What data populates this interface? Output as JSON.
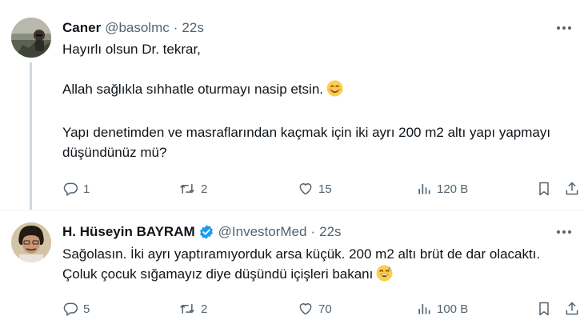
{
  "tweets": [
    {
      "author": {
        "name": "Caner",
        "handle": "@basolmc",
        "verified": false
      },
      "time": "22s",
      "separator": "·",
      "text": [
        "Hayırlı olsun Dr. tekrar,",
        "Allah sağlıkla sıhhatle oturmayı nasip etsin.",
        "Yapı denetimden ve masraflarından kaçmak için iki ayrı 200 m2 altı yapı yapmayı düşündünüz mü?"
      ],
      "emoji": "smiling-face-emoji",
      "stats": {
        "replies": "1",
        "reposts": "2",
        "likes": "15",
        "views": "120 B"
      }
    },
    {
      "author": {
        "name": "H. Hüseyin BAYRAM",
        "handle": "@InvestorMed",
        "verified": true
      },
      "time": "22s",
      "separator": "·",
      "text": [
        "Sağolasın. İki ayrı yaptıramıyorduk arsa küçük. 200 m2 altı brüt de dar olacaktı. Çoluk çocuk sığamayız diye düşündü içişleri bakanı"
      ],
      "emoji": "grinning-sweat-emoji",
      "stats": {
        "replies": "5",
        "reposts": "2",
        "likes": "70",
        "views": "100 B"
      }
    }
  ],
  "colors": {
    "text": "#0f1419",
    "secondary": "#536471",
    "verified": "#1d9bf0",
    "thread_line": "#cfd9de",
    "divider": "#eff3f4"
  },
  "icons": [
    "more-icon",
    "reply-icon",
    "repost-icon",
    "like-icon",
    "views-icon",
    "bookmark-icon",
    "share-icon",
    "verified-badge-icon"
  ]
}
